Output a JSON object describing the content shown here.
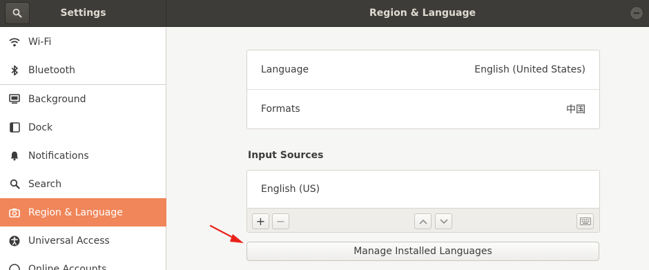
{
  "header": {
    "sidebar_title": "Settings",
    "main_title": "Region & Language"
  },
  "sidebar": {
    "items": [
      {
        "label": "Wi-Fi",
        "icon": "wifi-icon"
      },
      {
        "label": "Bluetooth",
        "icon": "bluetooth-icon"
      },
      {
        "label": "Background",
        "icon": "background-icon"
      },
      {
        "label": "Dock",
        "icon": "dock-icon"
      },
      {
        "label": "Notifications",
        "icon": "bell-icon"
      },
      {
        "label": "Search",
        "icon": "search-icon"
      },
      {
        "label": "Region & Language",
        "icon": "camera-icon",
        "active": true
      },
      {
        "label": "Universal Access",
        "icon": "accessibility-icon"
      },
      {
        "label": "Online Accounts",
        "icon": "accounts-icon"
      }
    ]
  },
  "region": {
    "language_label": "Language",
    "language_value": "English (United States)",
    "formats_label": "Formats",
    "formats_value": "中国"
  },
  "input_sources": {
    "title": "Input Sources",
    "items": [
      "English (US)"
    ],
    "add_label": "+",
    "remove_label": "−"
  },
  "manage_button": "Manage Installed Languages",
  "colors": {
    "accent": "#f0865a",
    "headerbar": "#3e3c38",
    "annotation_arrow": "#e8221b"
  }
}
